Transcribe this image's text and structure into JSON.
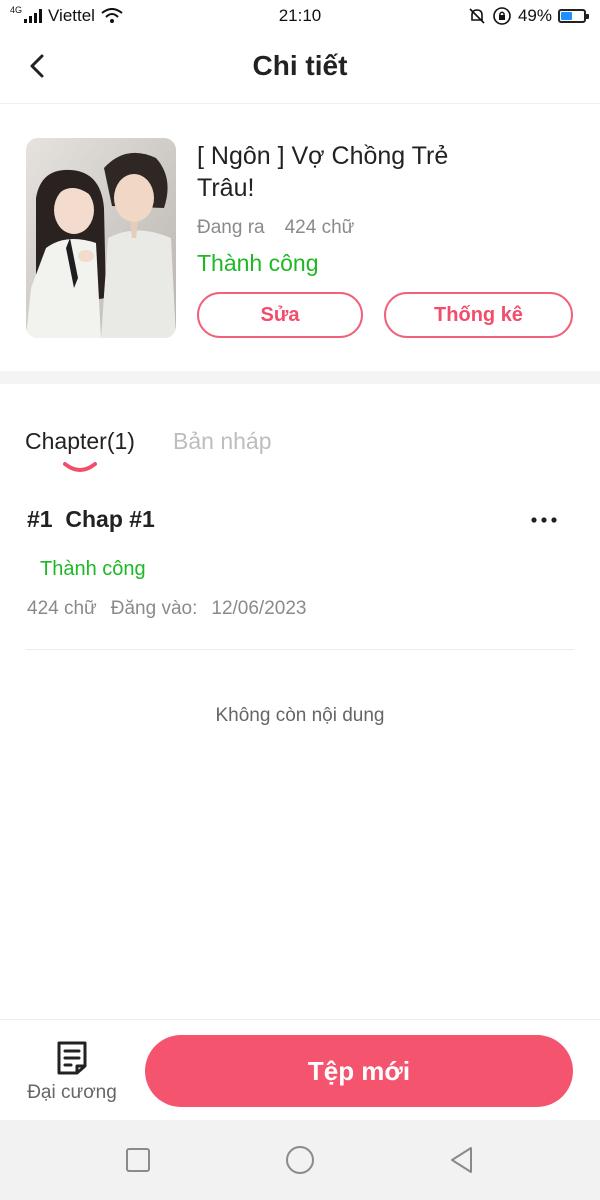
{
  "status_bar": {
    "network": "4G",
    "carrier": "Viettel",
    "time": "21:10",
    "battery_percent": "49%",
    "battery_level": 0.49
  },
  "header": {
    "title": "Chi tiết",
    "back_icon": "chevron-left-icon"
  },
  "book": {
    "cover_icon": "book-cover-image",
    "title": "[ Ngôn ] Vợ Chồng Trẻ Trâu!",
    "state": "Đang ra",
    "word_count": "424 chữ",
    "status": "Thành công",
    "edit_label": "Sửa",
    "stats_label": "Thống kê"
  },
  "tabs": [
    {
      "label": "Chapter(1)",
      "active": true
    },
    {
      "label": "Bản nháp",
      "active": false
    }
  ],
  "chapters": [
    {
      "number": "#1",
      "name": "Chap #1",
      "status": "Thành công",
      "word_count": "424 chữ",
      "posted_label": "Đăng vào:",
      "posted_date": "12/06/2023"
    }
  ],
  "empty_note": "Không còn nội dung",
  "bottom": {
    "outline_label": "Đại cương",
    "new_chapter_label": "Tệp mới"
  },
  "colors": {
    "accent": "#f5546f",
    "success": "#1db923",
    "muted": "#8a8a8a"
  }
}
